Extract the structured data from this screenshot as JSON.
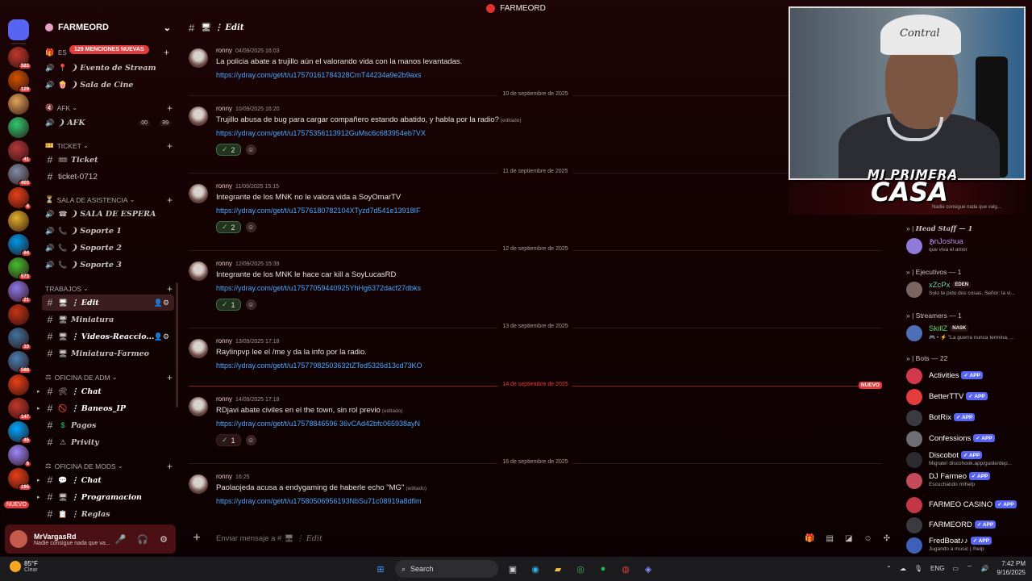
{
  "window": {
    "title": "FARMEORD"
  },
  "rail": {
    "servers": [
      {
        "color": "#c0392b",
        "badge": "583"
      },
      {
        "color": "#d35400",
        "badge": "129"
      },
      {
        "color": "#e0a458",
        "badge": ""
      },
      {
        "color": "#2ecc71",
        "badge": ""
      },
      {
        "color": "#b33939",
        "badge": "41"
      },
      {
        "color": "#7f8fa6",
        "badge": "403"
      },
      {
        "color": "#e84118",
        "badge": "4"
      },
      {
        "color": "#e1b12c",
        "badge": ""
      },
      {
        "color": "#0097e6",
        "badge": "64"
      },
      {
        "color": "#44bd32",
        "badge": "573"
      },
      {
        "color": "#8c7ae6",
        "badge": "21"
      },
      {
        "color": "#c23616",
        "badge": ""
      },
      {
        "color": "#40739e",
        "badge": "10"
      },
      {
        "color": "#487eb0",
        "badge": "588"
      },
      {
        "color": "#e84118",
        "badge": ""
      },
      {
        "color": "#c0392b",
        "badge": "147"
      },
      {
        "color": "#00a8ff",
        "badge": "45"
      },
      {
        "color": "#9c88ff",
        "badge": "6"
      },
      {
        "color": "#e84118",
        "badge": "195"
      }
    ],
    "new_label": "NUEVO"
  },
  "sidebar": {
    "server_name": "FARMEORD",
    "mentions_pill": "129 MENCIONES NUEVAS",
    "es_prefix": "ES",
    "categories": {
      "afk": "AFK",
      "ticket": "TICKET",
      "asistencia": "SALA DE ASISTENCIA",
      "trabajos": "TRABAJOS",
      "oficina_adm": "OFICINA DE ADM",
      "oficina_mods": "OFICINA DE MODS"
    },
    "channels": {
      "evento": "❩ Evento de Stream",
      "cine": "❩ Sala de Cine",
      "afk": "❩ AFK",
      "afk_count_a": "00",
      "afk_count_b": "99",
      "ticket": "Ticket",
      "ticket0712": "ticket-0712",
      "espera": "❩ SALA DE ESPERA",
      "soporte1": "❩ Soporte 1",
      "soporte2": "❩ Soporte 2",
      "soporte3": "❩ Soporte 3",
      "edit": "⋮ Edit",
      "miniatura": "Miniatura",
      "videos": "⋮ Videos-Reaccio...",
      "miniatura_farmeo": "Miniatura-Farmeo",
      "chat_adm": "⋮ Chat",
      "baneos": "⋮ Baneos_IP",
      "pagos": "Pagos",
      "privity": "Privity",
      "chat_mods": "⋮ Chat",
      "programacion": "⋮ Programacion",
      "reglas": "⋮ Reglas"
    }
  },
  "user_panel": {
    "name": "MrVargasRd",
    "status": "Nadie consigue nada que va..."
  },
  "chat": {
    "channel_title": "⋮ Edit",
    "composer_placeholder": "Enviar mensaje a #",
    "composer_channel": "⋮ Edit",
    "messages": [
      {
        "author": "ronny",
        "time": "04/09/2025 16:03",
        "text": "La policia abate a trujillo aún el valorando vida con la manos levantadas.",
        "edited": "",
        "link": "https://ydray.com/get/t/u17570161784328CrnT44234a9e2b9axs",
        "react_count": ""
      },
      {
        "author": "ronny",
        "time": "10/09/2025 16:20",
        "text": "Trujillo abusa de bug para cargar compañero estando abatido, y habla por la radio?",
        "edited": "(editado)",
        "link": "https://ydray.com/get/t/u17575356113912GuMsc6c683954eb7VX",
        "react_count": "2"
      },
      {
        "author": "ronny",
        "time": "11/09/2025 15:15",
        "text": "Integrante de los MNK no le valora vida a SoyOmarTV",
        "edited": "",
        "link": "https://ydray.com/get/t/u17576180782104XTyzd7d541e13918IF",
        "react_count": "2"
      },
      {
        "author": "ronny",
        "time": "12/09/2025 15:39",
        "text": "Integrante de los MNK le hace car kill a SoyLucasRD",
        "edited": "",
        "link": "https://ydray.com/get/t/u17577059440925YhHg6372dacf27dbks",
        "react_count": "1"
      },
      {
        "author": "ronny",
        "time": "13/09/2025 17:18",
        "text": "Raylinpvp lee el /me y da la info por la radio.",
        "edited": "",
        "link": "https://ydray.com/get/t/u17577982503632tZTed5326d13cd73KO",
        "react_count": ""
      },
      {
        "author": "ronny",
        "time": "14/09/2025 17:18",
        "text": "RDjavi abate civiles en el the town, sin rol previo",
        "edited": "(editado)",
        "link": "https://ydray.com/get/t/u17578846596 36vCAd42bfc065938ayN",
        "react_count": "1"
      },
      {
        "author": "ronny",
        "time": "16:25",
        "text": "Paolaojeda acusa a endygaming de haberle echo \"MG\"",
        "edited": "(editado)",
        "link": "https://ydray.com/get/t/u17580506956193NbSu71c08919a8dflm",
        "react_count": ""
      }
    ],
    "dividers": [
      "10 de septiembre de 2025",
      "11 de septiembre de 2025",
      "12 de septiembre de 2025",
      "13 de septiembre de 2025",
      "14 de septiembre de 2025",
      "16 de septiembre de 2025"
    ],
    "new_badge": "NUEVO"
  },
  "overlay": {
    "cap_text": "Contral",
    "logo_line1": "MI PRIMERA",
    "logo_line2": "CASA",
    "note": "Nadie consigue nada que valg..."
  },
  "members": {
    "head_staff": "Head Staff — 1",
    "ejecutivos": "Ejecutivos — 1",
    "streamers": "Streamers — 1",
    "bots": "Bots — 22",
    "list": [
      {
        "name": "𝕳nJoshua",
        "sub": "que viva el amor",
        "color": "#b48ee8",
        "tag": "",
        "badge": ""
      },
      {
        "name": "xZcPx",
        "sub": "Solo te pido dos cosas, Señor: la vi...",
        "color": "#6fd3a6",
        "tag": "",
        "badge": "EDEN"
      },
      {
        "name": "SkillZ",
        "sub": "🎮 • ⚡ \"La guerra nunca termina, ...",
        "color": "#5cdb5c",
        "tag": "",
        "badge": "NASK"
      },
      {
        "name": "Activities",
        "sub": "",
        "color": "#ffffff",
        "tag": "APP",
        "badge": ""
      },
      {
        "name": "BetterTTV",
        "sub": "",
        "color": "#ffffff",
        "tag": "APP",
        "badge": ""
      },
      {
        "name": "BotRix",
        "sub": "",
        "color": "#ffffff",
        "tag": "APP",
        "badge": ""
      },
      {
        "name": "Confessions",
        "sub": "",
        "color": "#ffffff",
        "tag": "APP",
        "badge": ""
      },
      {
        "name": "Discobot",
        "sub": "Migrate! discohook.app/guide/dep...",
        "color": "#ffffff",
        "tag": "APP",
        "badge": ""
      },
      {
        "name": "DJ Farmeo",
        "sub": "Escuchando m!help",
        "color": "#ffffff",
        "tag": "APP",
        "badge": ""
      },
      {
        "name": "FARMEO CASINO",
        "sub": "",
        "color": "#ffffff",
        "tag": "APP",
        "badge": ""
      },
      {
        "name": "FARMEORD",
        "sub": "",
        "color": "#ffffff",
        "tag": "APP",
        "badge": ""
      },
      {
        "name": "FredBoat♪♪",
        "sub": "Jugando a music | /help",
        "color": "#ffffff",
        "tag": "APP",
        "badge": ""
      }
    ]
  },
  "taskbar": {
    "temp": "85°F",
    "condition": "Clear",
    "search": "Search",
    "lang": "ENG",
    "time": "7:42 PM",
    "date": "9/16/2025"
  }
}
